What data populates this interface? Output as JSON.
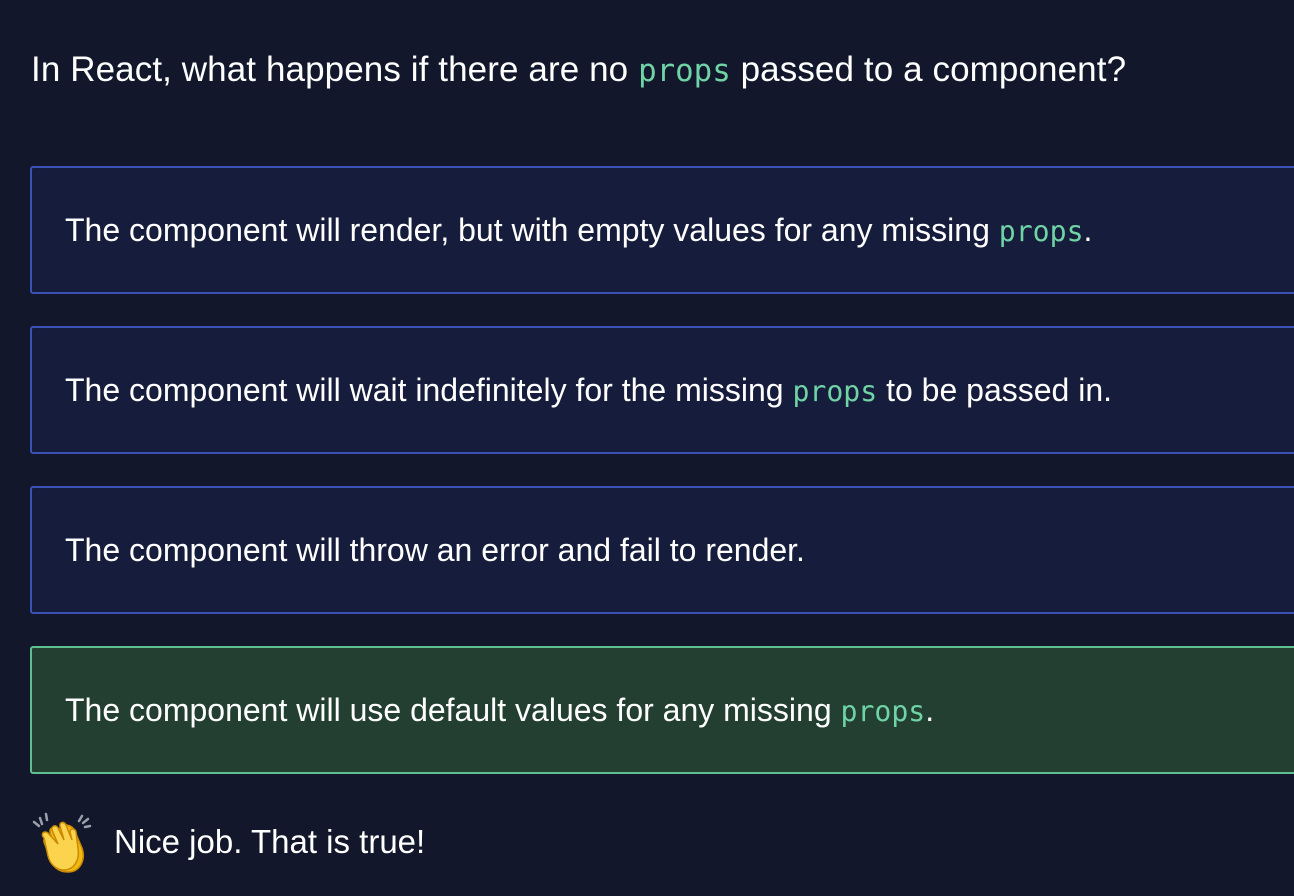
{
  "question": {
    "prefix": "In React, what happens if there are no ",
    "code": "props",
    "suffix": " passed to a component?"
  },
  "options": [
    {
      "prefix": "The component will render, but with empty values for any missing ",
      "code": "props",
      "suffix": ".",
      "state": "default"
    },
    {
      "prefix": "The component will wait indefinitely for the missing ",
      "code": "props",
      "suffix": " to be passed in.",
      "state": "default"
    },
    {
      "prefix": "The component will throw an error and fail to render.",
      "state": "default"
    },
    {
      "prefix": "The component will use default values for any missing ",
      "code": "props",
      "suffix": ".",
      "state": "correct"
    }
  ],
  "feedback": {
    "icon": "clapping-hands-icon",
    "text": "Nice job. That is true!"
  },
  "colors": {
    "background": "#12172b",
    "option_background": "#161c3b",
    "option_border": "#3a52b4",
    "correct_background": "#233f32",
    "correct_border": "#5fbf90",
    "code_text": "#6fd3a6"
  }
}
